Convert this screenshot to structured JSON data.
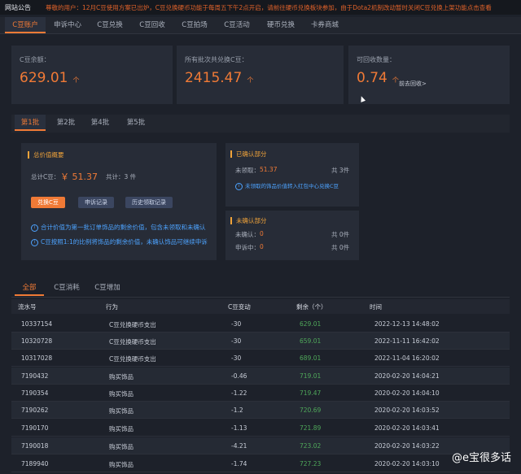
{
  "announcement": {
    "tag": "网站公告",
    "message": "尊敬的用户：12月C豆使用方案已出炉，C豆兑换硬币功能于每周五下午2点开启，请前往硬币兑换板块参加，由于Dota2机制改动暂时关闭C豆兑换上架功能点击查看"
  },
  "nav": {
    "items": [
      {
        "label": "C豆账户",
        "active": true
      },
      {
        "label": "申诉中心",
        "active": false
      },
      {
        "label": "C豆兑换",
        "active": false
      },
      {
        "label": "C豆回收",
        "active": false
      },
      {
        "label": "C豆拍场",
        "active": false
      },
      {
        "label": "C豆活动",
        "active": false
      },
      {
        "label": "硬币兑换",
        "active": false
      },
      {
        "label": "卡券商城",
        "active": false
      }
    ]
  },
  "stats": {
    "balance": {
      "label": "C豆余额：",
      "value": "629.01",
      "unit": "个"
    },
    "total": {
      "label": "所有批次共兑换C豆：",
      "value": "2415.47",
      "unit": "个"
    },
    "recyclable": {
      "label": "可回收数量：",
      "value": "0.74",
      "unit": "个",
      "link": "前去回收>"
    }
  },
  "batches": [
    "第1批",
    "第2批",
    "第4批",
    "第5批"
  ],
  "overview": {
    "title": "总价值概要",
    "total_label": "总计C豆：",
    "total_value": "￥ 51.37",
    "count_label": "共计：3 件",
    "buttons": {
      "exchange": "兑换C豆",
      "apply": "申诉记录",
      "history": "历史领取记录"
    },
    "notes": [
      "合计价值为第一批订单饰品的剩余价值，包含未领取和未确认",
      "C豆按照1:1的比例将饰品的剩余价值，未确认饰品可继续申诉"
    ]
  },
  "confirmed": {
    "title": "已确认部分",
    "row_label": "未领取：",
    "row_value": "51.37",
    "row_count": "共 3件",
    "note": "未领取的饰品价值转入红包中心兑换C豆"
  },
  "unconfirmed": {
    "title": "未确认部分",
    "rows": [
      {
        "label": "未确认：",
        "value": "0",
        "count": "共 0件"
      },
      {
        "label": "申诉中：",
        "value": "0",
        "count": "共 0件"
      }
    ]
  },
  "record_tabs": [
    "全部",
    "C豆消耗",
    "C豆增加"
  ],
  "table": {
    "headers": [
      "流水号",
      "行为",
      "C豆变动",
      "剩余（个）",
      "时间"
    ],
    "rows": [
      [
        "10337154",
        "C豆兑换硬币支出",
        "-30",
        "629.01",
        "2022-12-13 14:48:02"
      ],
      [
        "10320728",
        "C豆兑换硬币支出",
        "-30",
        "659.01",
        "2022-11-11 16:42:02"
      ],
      [
        "10317028",
        "C豆兑换硬币支出",
        "-30",
        "689.01",
        "2022-11-04 16:20:02"
      ],
      [
        "7190432",
        "购买饰品",
        "-0.46",
        "719.01",
        "2020-02-20 14:04:21"
      ],
      [
        "7190354",
        "购买饰品",
        "-1.22",
        "719.47",
        "2020-02-20 14:04:10"
      ],
      [
        "7190262",
        "购买饰品",
        "-1.2",
        "720.69",
        "2020-02-20 14:03:52"
      ],
      [
        "7190170",
        "购买饰品",
        "-1.13",
        "721.89",
        "2020-02-20 14:03:41"
      ],
      [
        "7190018",
        "购买饰品",
        "-4.21",
        "723.02",
        "2020-02-20 14:03:22"
      ],
      [
        "7189940",
        "购买饰品",
        "-1.74",
        "727.23",
        "2020-02-20 14:03:10"
      ]
    ]
  },
  "watermark": "@e宝很多话",
  "colors": {
    "accent": "#f07a36",
    "info": "#4da3ff",
    "positive": "#4fa85a"
  }
}
